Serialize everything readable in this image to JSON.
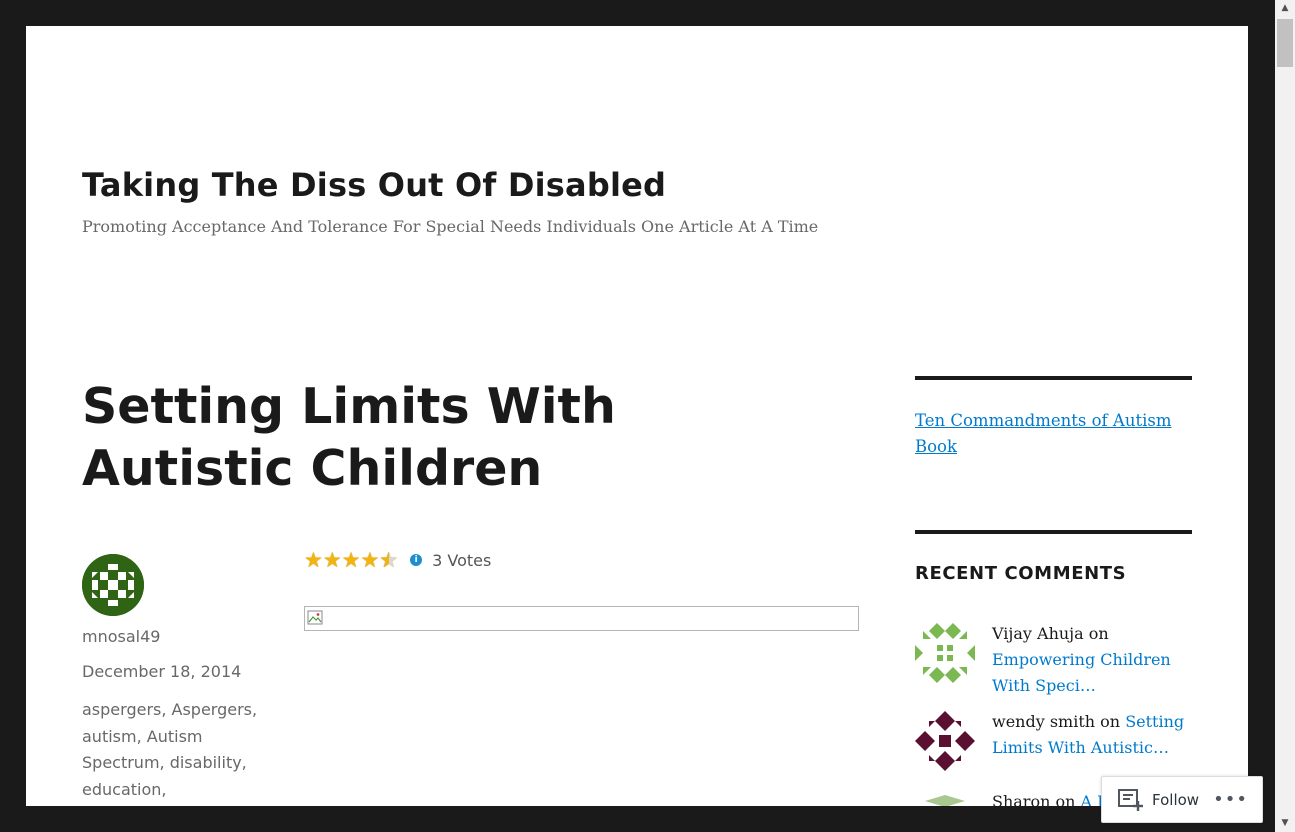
{
  "site": {
    "title": "Taking The Diss Out Of Disabled",
    "tagline": "Promoting Acceptance And Tolerance For Special Needs Individuals One Article At A Time"
  },
  "post": {
    "title": "Setting Limits With Autistic Children",
    "author": "mnosal49",
    "date": "December 18, 2014",
    "tags": "aspergers, Aspergers, autism, Autism Spectrum, disability, education,",
    "rating": {
      "value": 4.5,
      "max": 5,
      "votes_label": "3 Votes"
    }
  },
  "sidebar": {
    "link": "Ten Commandments of Autism Book",
    "recent_comments_title": "RECENT COMMENTS",
    "comments": [
      {
        "author_on": "Vijay Ahuja on ",
        "link": "Empowering Children With Speci…"
      },
      {
        "author_on": "wendy smith on ",
        "link": "Setting Limits With Autistic…"
      },
      {
        "author_on": "Sharon on ",
        "link": "A P…"
      }
    ]
  },
  "follow": {
    "label": "Follow",
    "more": "•••"
  },
  "colors": {
    "link": "#007acc",
    "frame": "#1a1a1a",
    "star": "#f2b50f"
  }
}
